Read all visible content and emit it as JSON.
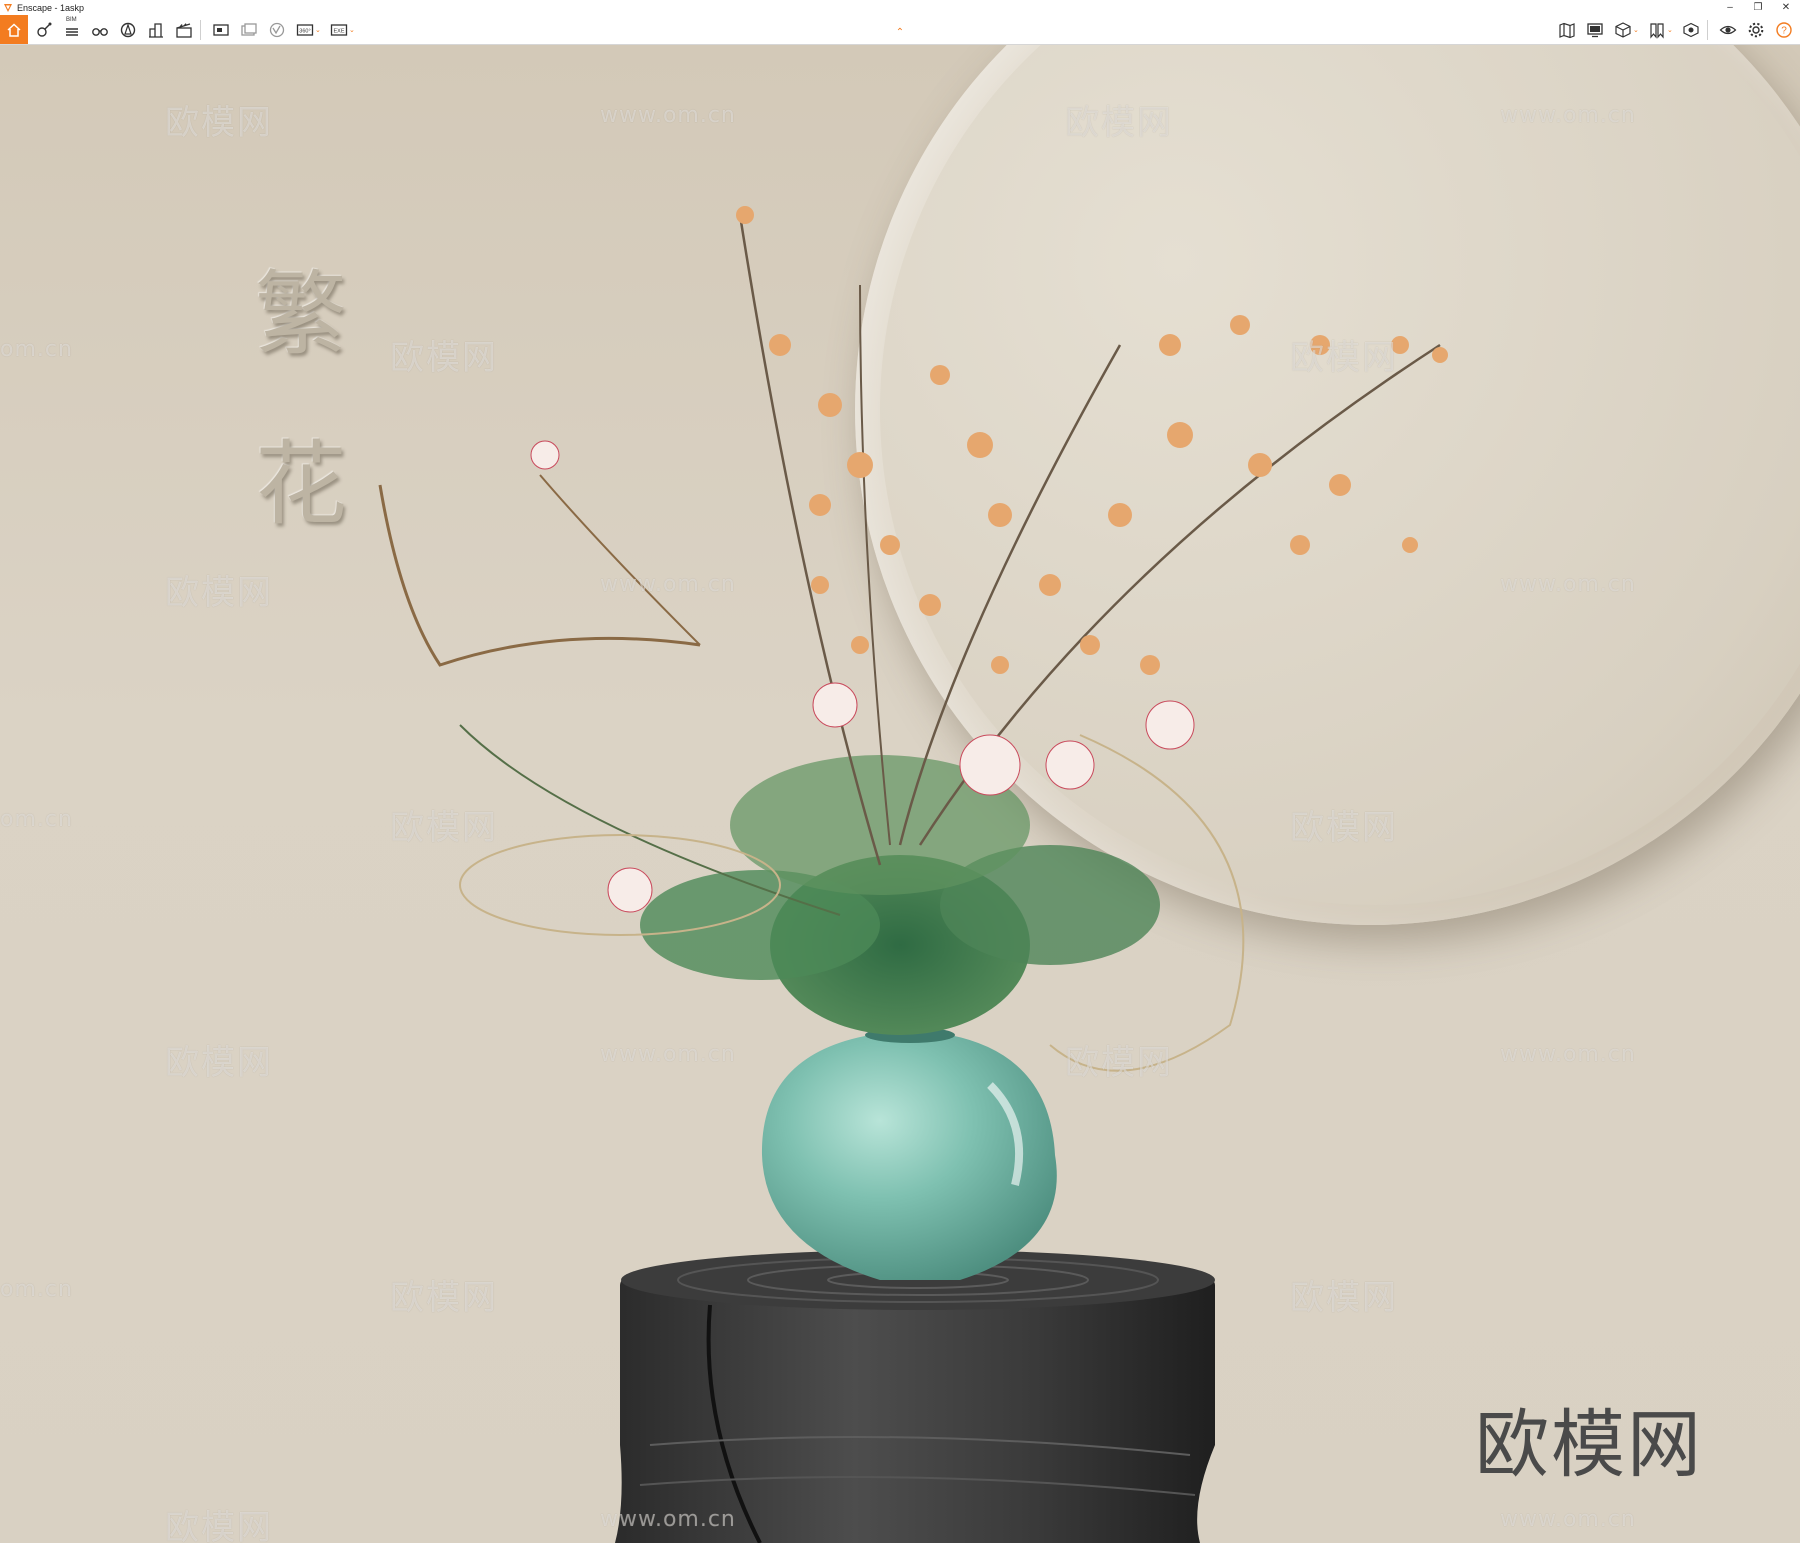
{
  "window": {
    "title": "Enscape - 1askp",
    "controls": [
      "–",
      "❐",
      "✕"
    ]
  },
  "toolbar": {
    "home_icon": "home-icon",
    "left_buttons": [
      {
        "name": "capture-icon"
      },
      {
        "name": "bim-icon",
        "label": "BIM"
      },
      {
        "name": "binoculars-icon"
      },
      {
        "name": "asset-library-icon"
      },
      {
        "name": "buildings-icon"
      },
      {
        "name": "clapboard-icon"
      },
      {
        "name": "screenshot-icon"
      },
      {
        "name": "batch-render-icon"
      },
      {
        "name": "vr-icon"
      },
      {
        "name": "panorama-icon",
        "label": "360°"
      },
      {
        "name": "export-exe-icon",
        "label": "EXE"
      }
    ],
    "right_buttons": [
      {
        "name": "map-icon"
      },
      {
        "name": "screen-icon"
      },
      {
        "name": "cube-icon"
      },
      {
        "name": "views-icon"
      },
      {
        "name": "material-icon"
      },
      {
        "name": "visibility-icon"
      },
      {
        "name": "settings-icon"
      },
      {
        "name": "help-icon"
      }
    ],
    "accent_color": "#f37c20"
  },
  "viewport": {
    "calligraphy": [
      "繁",
      "花"
    ],
    "watermark_cn": "欧模网",
    "watermark_url": "www.om.cn",
    "watermark_url_fragment": "om.cn",
    "logo_text": "欧模网"
  }
}
